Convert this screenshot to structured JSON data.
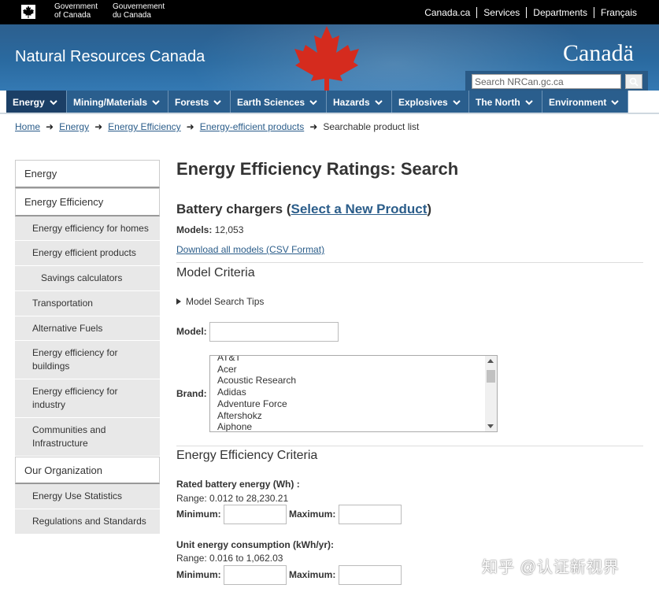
{
  "topbar": {
    "gov_en": [
      "Government",
      "of Canada"
    ],
    "gov_fr": [
      "Gouvernement",
      "du Canada"
    ],
    "links": [
      "Canada.ca",
      "Services",
      "Departments",
      "Français"
    ]
  },
  "banner": {
    "department": "Natural Resources Canada",
    "wordmark": "Canadä",
    "search_placeholder": "Search NRCan.gc.ca"
  },
  "nav": [
    "Energy",
    "Mining/Materials",
    "Forests",
    "Earth Sciences",
    "Hazards",
    "Explosives",
    "The North",
    "Environment"
  ],
  "breadcrumb": {
    "links": [
      "Home",
      "Energy",
      "Energy Efficiency",
      "Energy-efficient products"
    ],
    "current": "Searchable product list"
  },
  "sidebar": {
    "items": [
      {
        "label": "Energy",
        "type": "h"
      },
      {
        "label": "Energy Efficiency",
        "type": "h"
      },
      {
        "label": "Energy efficiency for homes",
        "type": "sub"
      },
      {
        "label": "Energy efficient products",
        "type": "sub"
      },
      {
        "label": "Savings calculators",
        "type": "deep"
      },
      {
        "label": "Transportation",
        "type": "sub"
      },
      {
        "label": "Alternative Fuels",
        "type": "sub"
      },
      {
        "label": "Energy efficiency for buildings",
        "type": "sub"
      },
      {
        "label": "Energy efficiency for industry",
        "type": "sub"
      },
      {
        "label": "Communities and Infrastructure",
        "type": "sub"
      },
      {
        "label": "Our Organization",
        "type": "h"
      },
      {
        "label": "Energy Use Statistics",
        "type": "sub"
      },
      {
        "label": "Regulations and Standards",
        "type": "sub"
      }
    ]
  },
  "main": {
    "title": "Energy Efficiency Ratings: Search",
    "product": "Battery chargers",
    "select_link": "Select a New Product",
    "models_label": "Models:",
    "models_count": "12,053",
    "download_link": "Download all models (CSV Format)",
    "model_criteria": "Model Criteria",
    "tips": "Model Search Tips",
    "model_label": "Model:",
    "brand_label": "Brand:",
    "brands": [
      "AT&T",
      "Acer",
      "Acoustic Research",
      "Adidas",
      "Adventure Force",
      "Aftershokz",
      "Aiphone"
    ],
    "ee_criteria": "Energy Efficiency Criteria",
    "rated_label": "Rated battery energy (Wh) :",
    "rated_range": "Range: 0.012 to 28,230.21",
    "unit_label": "Unit energy consumption (kWh/yr):",
    "unit_range": "Range: 0.016 to 1,062.03",
    "min_label": "Minimum:",
    "max_label": "Maximum:"
  },
  "watermark": "知乎 @认证新视界",
  "colors": {
    "nav": "#2a5e8d",
    "link": "#2b5d8a",
    "leaf": "#d52b1e"
  }
}
